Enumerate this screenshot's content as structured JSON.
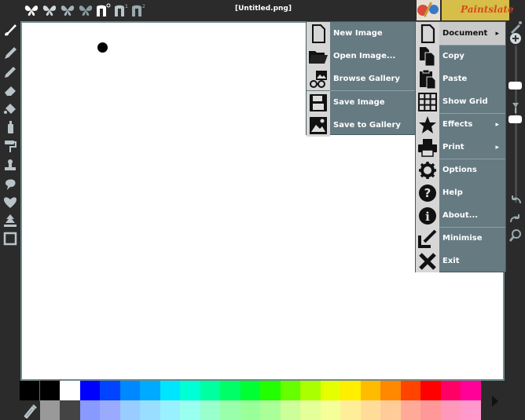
{
  "window": {
    "title": "[Untitled.png]",
    "brand": "Paintslate"
  },
  "top_icons": [
    "butterfly-white-icon",
    "butterfly-light-icon",
    "butterfly-gray-icon",
    "butterfly-dark-icon",
    "n-brush-0-icon",
    "n-brush-1-icon",
    "n-brush-2-icon"
  ],
  "tools": [
    "brush-icon",
    "pen-icon",
    "pencil-icon",
    "eraser-icon",
    "fill-bucket-icon",
    "spray-can-icon",
    "roller-icon",
    "stamp-icon",
    "smudge-icon",
    "heart-shape-icon",
    "tree-shape-icon",
    "frame-icon"
  ],
  "submenu": {
    "items": [
      {
        "label": "New Image",
        "icon": "new-image-icon"
      },
      {
        "label": "Open Image...",
        "icon": "open-folder-icon"
      },
      {
        "label": "Browse Gallery",
        "icon": "browse-gallery-icon"
      },
      {
        "label": "Save Image",
        "icon": "save-floppy-icon"
      },
      {
        "label": "Save to Gallery",
        "icon": "save-to-gallery-icon"
      }
    ]
  },
  "mainmenu": {
    "items": [
      {
        "label": "Document",
        "icon": "document-icon",
        "submenu": true,
        "active": true
      },
      {
        "label": "Copy",
        "icon": "copy-icon",
        "submenu": false
      },
      {
        "label": "Paste",
        "icon": "paste-icon",
        "submenu": false
      },
      {
        "label": "Show Grid",
        "icon": "grid-icon",
        "submenu": false
      },
      {
        "label": "Effects",
        "icon": "star-icon",
        "submenu": true
      },
      {
        "label": "Print",
        "icon": "printer-icon",
        "submenu": true
      },
      {
        "label": "Options",
        "icon": "gear-icon",
        "submenu": false
      },
      {
        "label": "Help",
        "icon": "help-icon",
        "submenu": false
      },
      {
        "label": "About...",
        "icon": "info-icon",
        "submenu": false
      },
      {
        "label": "Minimise",
        "icon": "minimise-arrow-icon",
        "submenu": false
      },
      {
        "label": "Exit",
        "icon": "close-x-icon",
        "submenu": false
      }
    ],
    "chevron": "▸"
  },
  "right_tools": [
    "brush-size-icon",
    "zoom-plus-icon",
    "opacity-icon",
    "undo-icon",
    "redo-icon",
    "magnifier-icon"
  ],
  "palette": {
    "row1": [
      "#000000",
      "#000000",
      "#ffffff",
      "#0000ff",
      "#0044ff",
      "#0088ff",
      "#00aaff",
      "#00e5ff",
      "#00ffd5",
      "#00ffa0",
      "#00ff66",
      "#00ff33",
      "#22ff00",
      "#66ff00",
      "#aaff00",
      "#e5ff00",
      "#ffee00",
      "#ffbb00",
      "#ff8800",
      "#ff4400",
      "#ff0000",
      "#ff0066",
      "#ff0099"
    ],
    "row2": [
      "#222222",
      "#999999",
      "#444444",
      "#8899ff",
      "#99aaff",
      "#99ccff",
      "#99ddff",
      "#99f0ff",
      "#99ffee",
      "#99ffcc",
      "#99ffaa",
      "#99ff99",
      "#aaff99",
      "#ccff99",
      "#e5ff99",
      "#f5ff99",
      "#ffee99",
      "#ffdd99",
      "#ffcc99",
      "#ffaa99",
      "#ff9999",
      "#ff99bb",
      "#ff99cc"
    ]
  }
}
